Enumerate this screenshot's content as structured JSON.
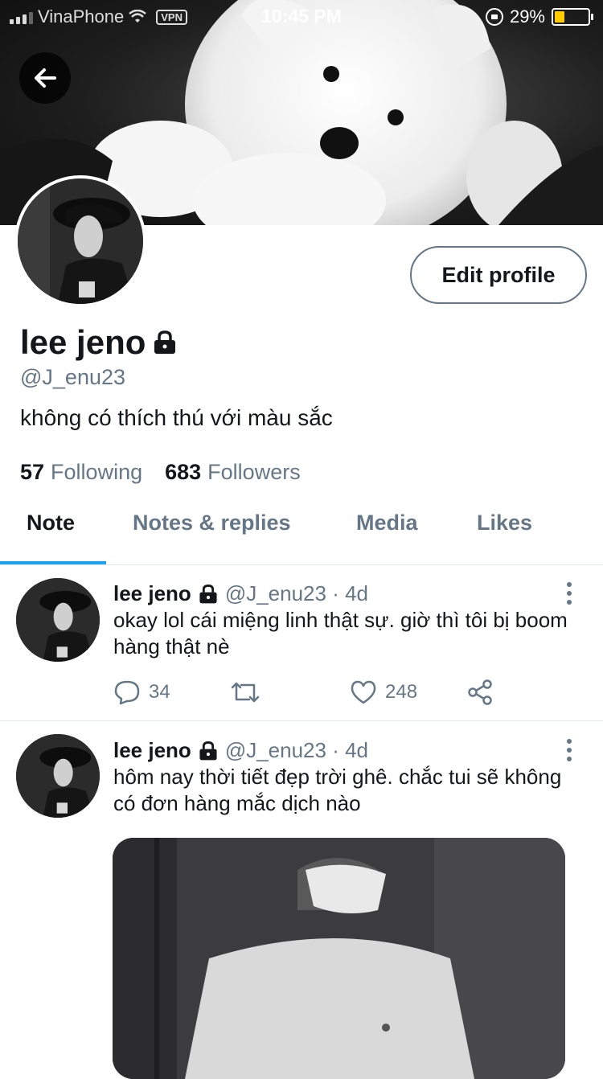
{
  "status_bar": {
    "carrier": "VinaPhone",
    "vpn": "VPN",
    "time": "10:45 PM",
    "battery": "29%",
    "battery_level": 0.29
  },
  "profile": {
    "name": "lee jeno",
    "handle": "@J_enu23",
    "bio": "không có thích thú với màu sắc",
    "edit_label": "Edit profile",
    "following_count": "57",
    "following_label": "Following",
    "followers_count": "683",
    "followers_label": "Followers"
  },
  "tabs": [
    {
      "label": "Note",
      "active": true
    },
    {
      "label": "Notes & replies",
      "active": false
    },
    {
      "label": "Media",
      "active": false
    },
    {
      "label": "Likes",
      "active": false
    }
  ],
  "tweets": [
    {
      "name": "lee jeno",
      "meta": "@J_enu23 · 4d",
      "text": "okay lol cái miệng linh thật sự. giờ thì tôi bị boom hàng thật nè",
      "replies": "34",
      "likes": "248"
    },
    {
      "name": "lee jeno",
      "meta": "@J_enu23 · 4d",
      "text": "hôm nay thời tiết đẹp trời ghê. chắc tui sẽ không có đơn hàng mắc dịch nào"
    }
  ],
  "colors": {
    "accent": "#1da1f2",
    "secondary_text": "#657786",
    "battery_low": "#ffcc00"
  }
}
